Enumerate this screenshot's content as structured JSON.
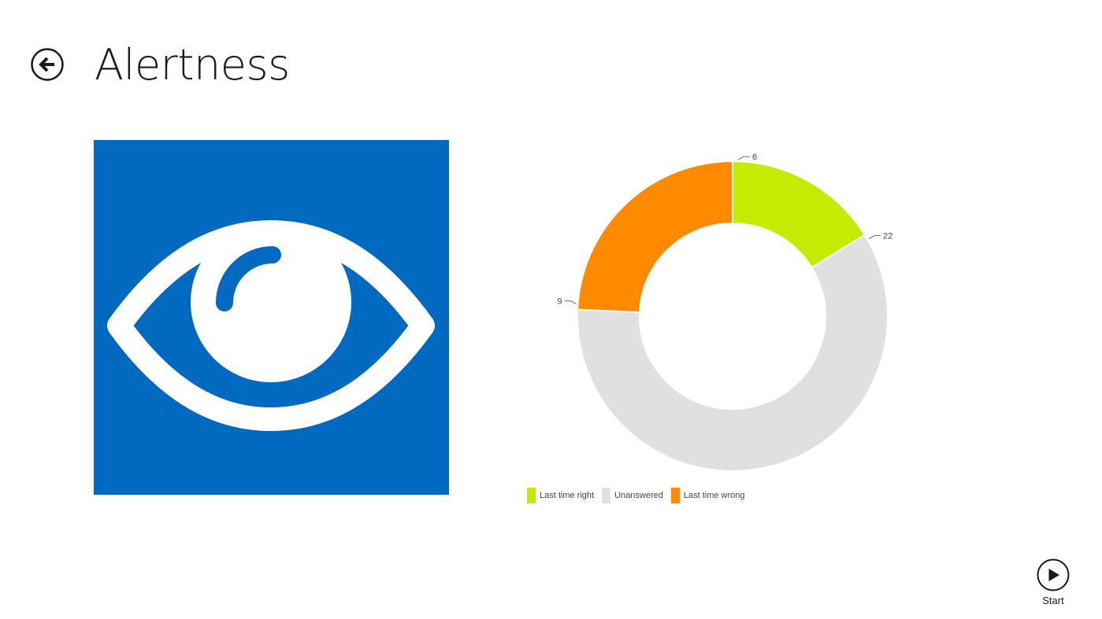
{
  "header": {
    "title": "Alertness",
    "back_icon": "back-arrow-icon"
  },
  "tile": {
    "icon": "eye-icon",
    "color": "#0069c0"
  },
  "chart_data": {
    "type": "pie",
    "donut": true,
    "categories": [
      "Last time right",
      "Unanswered",
      "Last time wrong"
    ],
    "values": [
      6,
      22,
      9
    ],
    "colors": [
      "#c5ec00",
      "#e0e0e0",
      "#ff8a00"
    ],
    "legend_position": "bottom-left"
  },
  "legend": {
    "items": [
      {
        "label": "Last time right",
        "color": "#c5ec00"
      },
      {
        "label": "Unanswered",
        "color": "#e0e0e0"
      },
      {
        "label": "Last time wrong",
        "color": "#ff8a00"
      }
    ]
  },
  "appbar": {
    "start_label": "Start",
    "start_icon": "play-icon"
  }
}
